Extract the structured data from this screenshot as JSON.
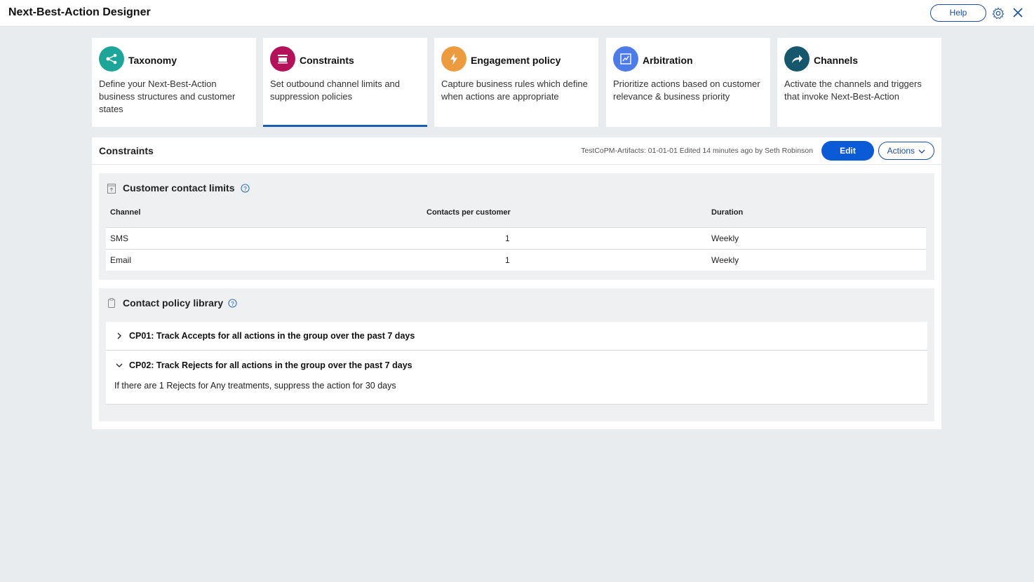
{
  "app": {
    "title": "Next-Best-Action Designer",
    "help_label": "Help"
  },
  "cards": [
    {
      "title": "Taxonomy",
      "desc": "Define your Next-Best-Action business structures and customer states",
      "color": "#1ea59a",
      "icon": "taxonomy-icon"
    },
    {
      "title": "Constraints",
      "desc": "Set outbound channel limits and suppression policies",
      "color": "#b3125a",
      "icon": "constraints-icon"
    },
    {
      "title": "Engagement policy",
      "desc": "Capture business rules which define when actions are appropriate",
      "color": "#ec9c3f",
      "icon": "lightning-icon"
    },
    {
      "title": "Arbitration",
      "desc": "Prioritize actions based on customer relevance & business priority",
      "color": "#4d7be8",
      "icon": "arbitration-icon"
    },
    {
      "title": "Channels",
      "desc": "Activate the channels and triggers that invoke Next-Best-Action",
      "color": "#17576e",
      "icon": "share-arrow-icon"
    }
  ],
  "panel": {
    "title": "Constraints",
    "meta": "TestCoPM-Artifacts: 01-01-01   Edited 14 minutes ago by Seth Robinson",
    "edit_label": "Edit",
    "actions_label": "Actions"
  },
  "contact_limits": {
    "title": "Customer contact limits",
    "headers": [
      "Channel",
      "Contacts per customer",
      "Duration"
    ],
    "rows": [
      {
        "channel": "SMS",
        "contacts": "1",
        "duration": "Weekly"
      },
      {
        "channel": "Email",
        "contacts": "1",
        "duration": "Weekly"
      }
    ]
  },
  "policy_library": {
    "title": "Contact policy library",
    "items": [
      {
        "title": "CP01: Track Accepts for all actions in the group over the past 7 days",
        "expanded": false
      },
      {
        "title": "CP02: Track Rejects for all actions in the group over the past 7 days",
        "expanded": true,
        "desc": "If there are 1 Rejects for Any treatments, suppress the action for 30 days"
      }
    ]
  },
  "colors": {
    "accent": "#0b5ad6",
    "active_underline": "#1a5fb4"
  }
}
